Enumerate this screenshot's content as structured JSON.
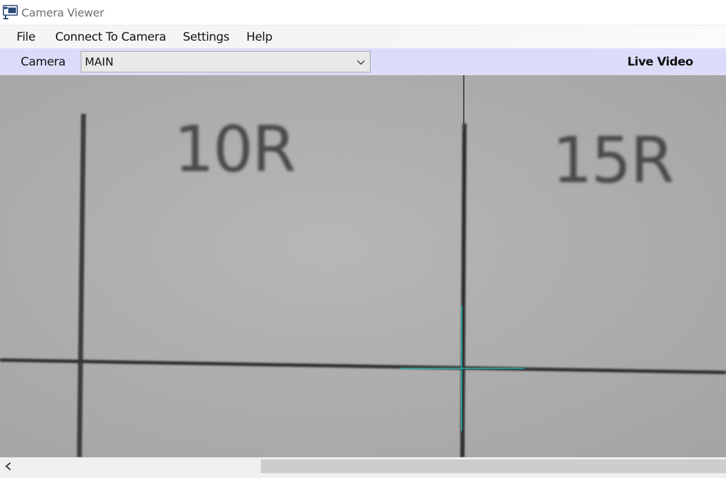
{
  "window": {
    "title": "Camera Viewer",
    "icon": "camera-app-icon"
  },
  "menu": {
    "items": [
      {
        "label": "File"
      },
      {
        "label": "Connect To Camera"
      },
      {
        "label": "Settings"
      },
      {
        "label": "Help"
      }
    ]
  },
  "toolbar": {
    "camera_label": "Camera",
    "camera_selected": "MAIN",
    "dropdown_icon": "chevron-down-icon",
    "status": "Live Video"
  },
  "video": {
    "markings": [
      "10R",
      "15R"
    ],
    "crosshair_color": "#1fb3b3"
  },
  "scrollbar": {
    "left_icon": "chevron-left-icon",
    "thumb_fraction": 0.64
  },
  "colors": {
    "toolbar_bg": "#dcdcfa",
    "menubar_bg": "#f5f5f5",
    "title_text": "#6e6e6e"
  }
}
